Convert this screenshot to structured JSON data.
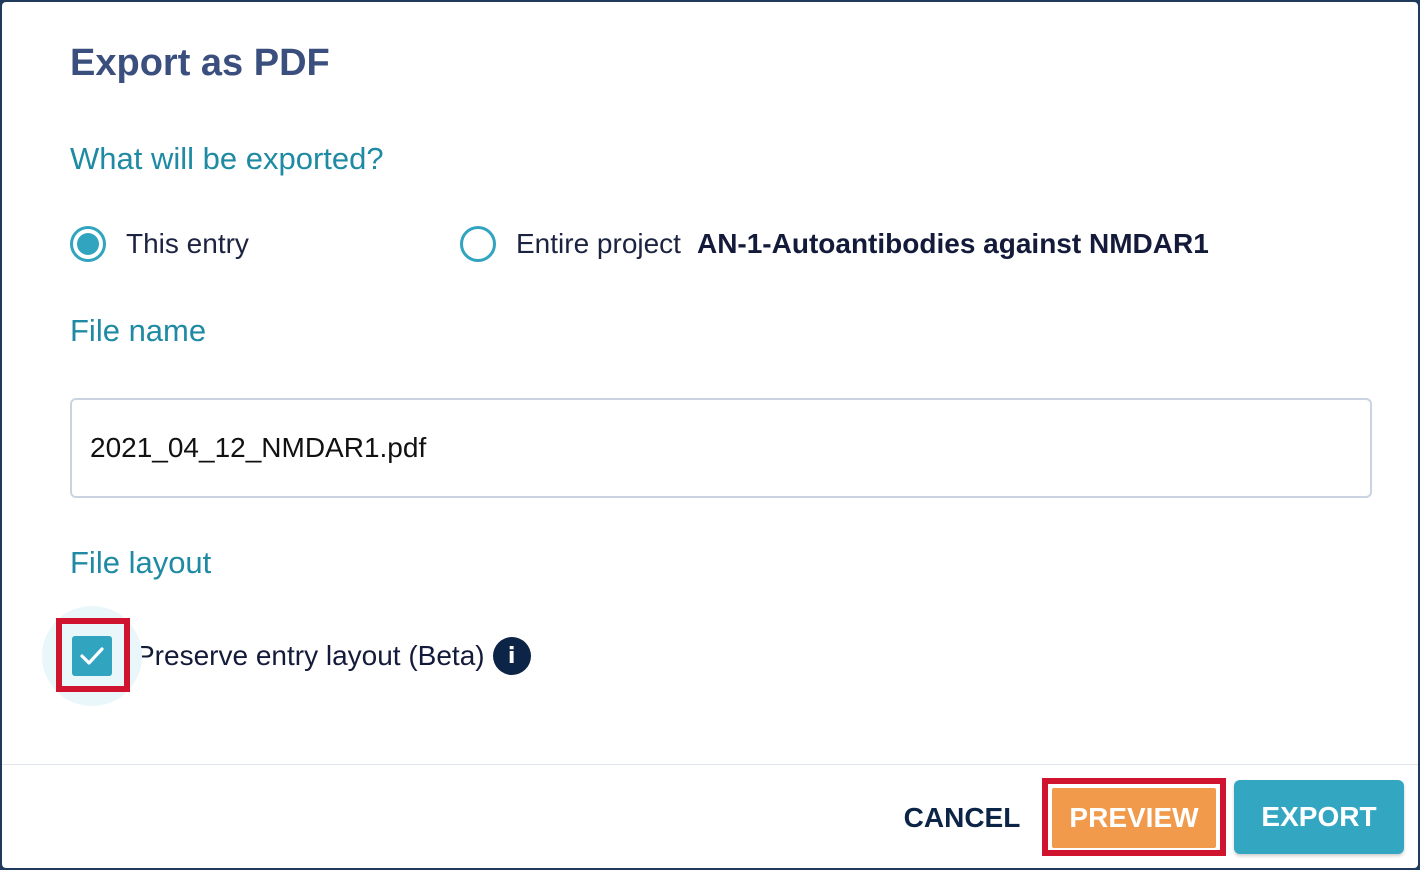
{
  "dialog": {
    "title": "Export as PDF"
  },
  "scope": {
    "label": "What will be exported?",
    "options": [
      {
        "label": "This entry",
        "selected": true
      },
      {
        "label": "Entire project",
        "project_name": "AN-1-Autoantibodies against NMDAR1",
        "selected": false
      }
    ]
  },
  "file_name": {
    "label": "File name",
    "value": "2021_04_12_NMDAR1.pdf"
  },
  "file_layout": {
    "label": "File layout",
    "preserve_layout_label": "Preserve entry layout (Beta)",
    "preserve_layout_checked": true,
    "info_icon_glyph": "i"
  },
  "buttons": {
    "cancel": "CANCEL",
    "preview": "PREVIEW",
    "export": "EXPORT"
  },
  "colors": {
    "title": "#3b4f7e",
    "section_label": "#1f8aa3",
    "accent": "#31a4bf",
    "preview_button": "#f19a4b",
    "export_button": "#33a6c2",
    "highlight": "#d0132e"
  },
  "icons": {
    "checkbox_check": "check-icon",
    "info": "info-icon"
  }
}
